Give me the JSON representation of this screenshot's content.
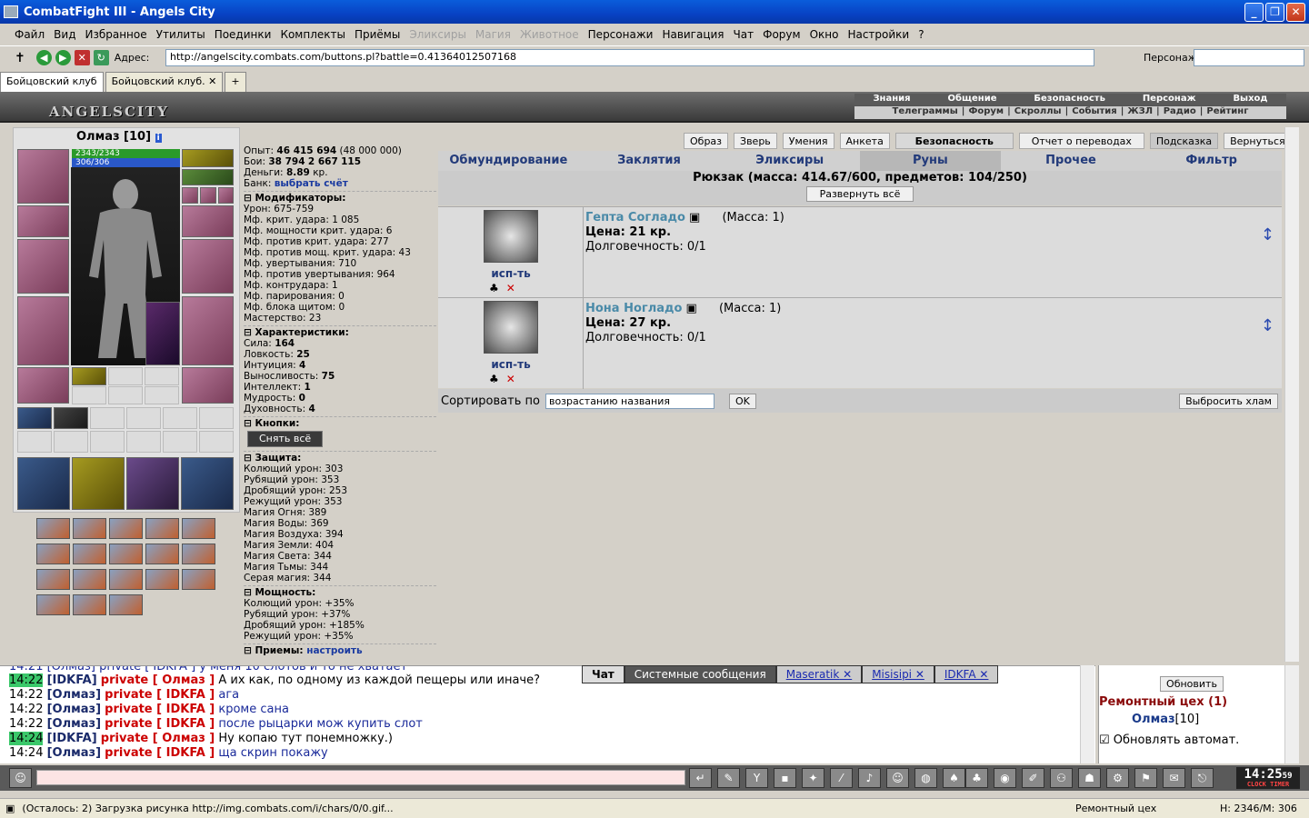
{
  "window": {
    "title": "CombatFight III - Angels City"
  },
  "menu": [
    "Файл",
    "Вид",
    "Избранное",
    "Утилиты",
    "Поединки",
    "Комплекты",
    "Приёмы",
    "Эликсиры",
    "Магия",
    "Животное",
    "Персонажи",
    "Навигация",
    "Чат",
    "Форум",
    "Окно",
    "Настройки",
    "?"
  ],
  "menu_disabled": [
    "Эликсиры",
    "Магия",
    "Животное"
  ],
  "address": {
    "label": "Адрес:",
    "url": "http://angelscity.combats.com/buttons.pl?battle=0.41364012507168",
    "person_label": "Персонаж:"
  },
  "tabs": [
    "Бойцовский клуб",
    "Бойцовский клуб."
  ],
  "game": {
    "logo": "ANGELSCITY",
    "topmenu1": [
      "Знания",
      "Общение",
      "Безопасность",
      "Персонаж",
      "Выход"
    ],
    "topmenu2": [
      "Телеграммы",
      "Форум",
      "Скроллы",
      "События",
      "ЖЗЛ",
      "Радио",
      "Рейтинг"
    ]
  },
  "character": {
    "name": "Олмаз [10]",
    "hp": "2343/2343",
    "mp": "306/306"
  },
  "stats": {
    "exp_label": "Опыт:",
    "exp": "46 415 694",
    "exp_next": "(48 000 000)",
    "battles_label": "Бои:",
    "battles": "38 794",
    "wins": "2 667",
    "losses": "115",
    "money_label": "Деньги:",
    "money": "8.89",
    "money_unit": "кр.",
    "bank_label": "Банк:",
    "bank_link": "выбрать счёт",
    "modifiers_title": "Модификаторы:",
    "modifiers": [
      "Урон: 675-759",
      "Мф. крит. удара: 1 085",
      "Мф. мощности крит. удара: 6",
      "Мф. против крит. удара: 277",
      "Мф. против мощ. крит. удара: 43",
      "Мф. увертывания: 710",
      "Мф. против увертывания: 964",
      "Мф. контрудара: 1",
      "Мф. парирования: 0",
      "Мф. блока щитом: 0",
      "Мастерство: 23"
    ],
    "chars_title": "Характеристики:",
    "chars": [
      [
        "Сила:",
        "164"
      ],
      [
        "Ловкость:",
        "25"
      ],
      [
        "Интуиция:",
        "4"
      ],
      [
        "Выносливость:",
        "75"
      ],
      [
        "Интеллект:",
        "1"
      ],
      [
        "Мудрость:",
        "0"
      ],
      [
        "Духовность:",
        "4"
      ]
    ],
    "buttons_title": "Кнопки:",
    "undress_btn": "Снять всё",
    "defense_title": "Защита:",
    "defense": [
      "Колющий урон: 303",
      "Рубящий урон: 353",
      "Дробящий урон: 253",
      "Режущий урон: 353",
      "Магия Огня: 389",
      "Магия Воды: 369",
      "Магия Воздуха: 394",
      "Магия Земли: 404",
      "Магия Света: 344",
      "Магия Тьмы: 344",
      "Серая магия: 344"
    ],
    "power_title": "Мощность:",
    "power": [
      "Колющий урон: +35%",
      "Рубящий урон: +37%",
      "Дробящий урон: +185%",
      "Режущий урон: +35%"
    ],
    "more_title": "Приемы:",
    "more_link": "настроить"
  },
  "topbuttons": [
    "Образ",
    "Зверь",
    "Умения",
    "Анкета",
    "Безопасность",
    "Отчет о переводах",
    "Подсказка",
    "Вернуться"
  ],
  "categories": [
    "Обмундирование",
    "Заклятия",
    "Эликсиры",
    "Руны",
    "Прочее",
    "Фильтр"
  ],
  "inventory": {
    "title": "Рюкзак (масса: 414.67/600, предметов: 104/250)",
    "expand": "Развернуть всё"
  },
  "items": [
    {
      "name": "Гепта Согладо",
      "mass": "(Масса: 1)",
      "price": "Цена: 21 кр.",
      "durability": "Долговечность: 0/1",
      "use": "исп-ть"
    },
    {
      "name": "Нона Ногладо",
      "mass": "(Масса: 1)",
      "price": "Цена: 27 кр.",
      "durability": "Долговечность: 0/1",
      "use": "исп-ть"
    }
  ],
  "sort": {
    "label": "Сортировать по",
    "value": "возрастанию названия",
    "ok": "OK",
    "trash": "Выбросить хлам"
  },
  "chat": {
    "partial": "14:21 [Олмаз] private [ IDKFA ] у меня 10 слотов и то не хватает",
    "lines": [
      {
        "time": "14:22",
        "hl": true,
        "nick": "[IDKFA]",
        "priv": "private [ Олмаз ]",
        "msg": "А их как, по одному из каждой пещеры или иначе?",
        "blk": true
      },
      {
        "time": "14:22",
        "hl": false,
        "nick": "[Олмаз]",
        "priv": "private [ IDKFA ]",
        "msg": "ага",
        "blk": false
      },
      {
        "time": "14:22",
        "hl": false,
        "nick": "[Олмаз]",
        "priv": "private [ IDKFA ]",
        "msg": "кроме сана",
        "blk": false
      },
      {
        "time": "14:22",
        "hl": false,
        "nick": "[Олмаз]",
        "priv": "private [ IDKFA ]",
        "msg": "после рыцарки мож купить слот",
        "blk": false
      },
      {
        "time": "14:24",
        "hl": true,
        "nick": "[IDKFA]",
        "priv": "private [ Олмаз ]",
        "msg": "Ну копаю тут понемножку.)",
        "blk": true
      },
      {
        "time": "14:24",
        "hl": false,
        "nick": "[Олмаз]",
        "priv": "private [ IDKFA ]",
        "msg": "ща скрин покажу",
        "blk": false
      }
    ],
    "tabs": [
      "Чат",
      "Системные сообщения",
      "Maseratik",
      "Misisipi",
      "IDKFA"
    ]
  },
  "room": {
    "refresh": "Обновить",
    "name": "Ремонтный цех (1)",
    "user": "Олмаз",
    "level": "[10]",
    "auto": "Обновлять автомат."
  },
  "clock": {
    "time": "14:25",
    "sec": "59",
    "l1": "CLOCK",
    "l2": "TIMER"
  },
  "status": {
    "text": "(Осталось: 2) Загрузка рисунка http://img.combats.com/i/chars/0/0.gif...",
    "room": "Ремонтный цех",
    "hp": "H: 2346/M: 306"
  }
}
